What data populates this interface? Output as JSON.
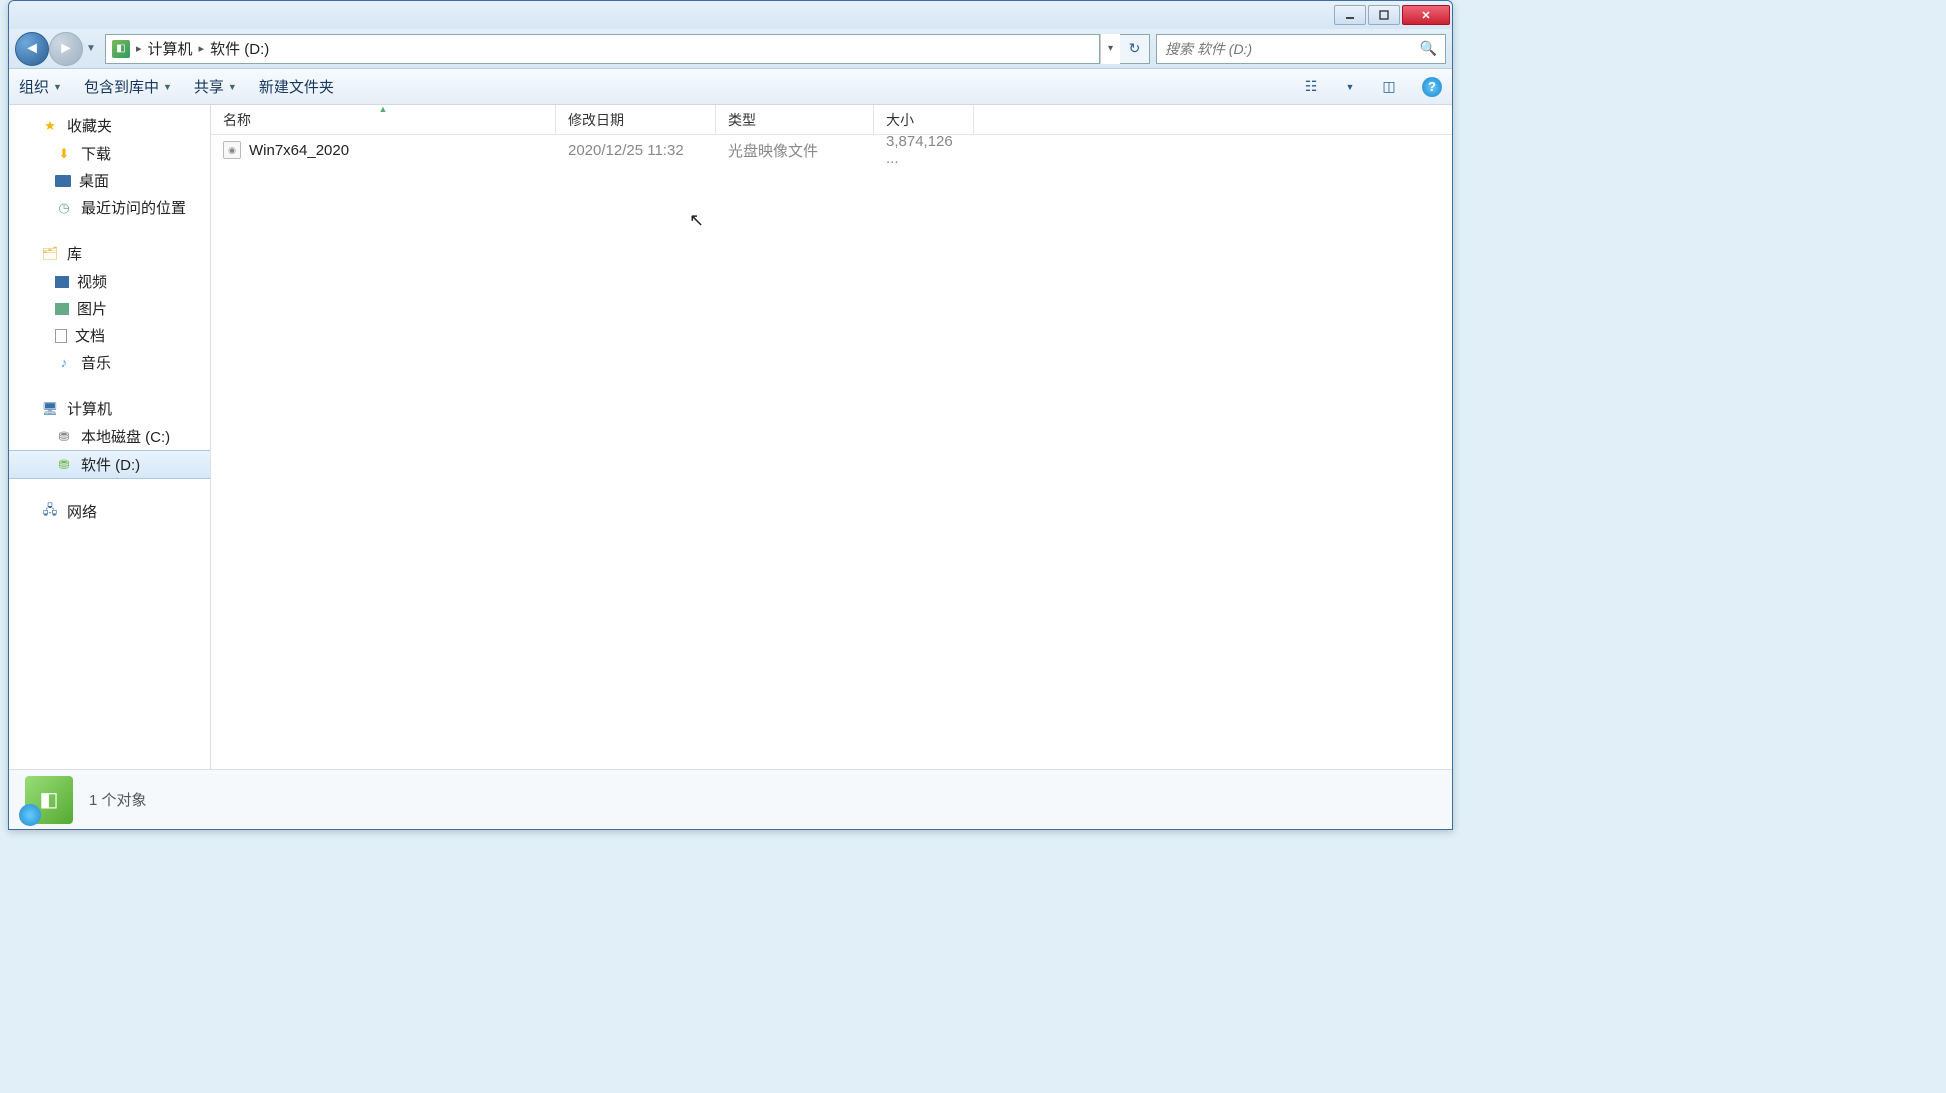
{
  "breadcrumb": {
    "root": "计算机",
    "current": "软件 (D:)"
  },
  "search": {
    "placeholder": "搜索 软件 (D:)"
  },
  "toolbar": {
    "organize": "组织",
    "include": "包含到库中",
    "share": "共享",
    "newfolder": "新建文件夹"
  },
  "columns": {
    "name": "名称",
    "date": "修改日期",
    "type": "类型",
    "size": "大小"
  },
  "files": [
    {
      "name": "Win7x64_2020",
      "date": "2020/12/25 11:32",
      "type": "光盘映像文件",
      "size": "3,874,126 ..."
    }
  ],
  "sidebar": {
    "favorites": "收藏夹",
    "downloads": "下载",
    "desktop": "桌面",
    "recent": "最近访问的位置",
    "libraries": "库",
    "videos": "视频",
    "pictures": "图片",
    "documents": "文档",
    "music": "音乐",
    "computer": "计算机",
    "drive_c": "本地磁盘 (C:)",
    "drive_d": "软件 (D:)",
    "network": "网络"
  },
  "status": {
    "text": "1 个对象"
  }
}
